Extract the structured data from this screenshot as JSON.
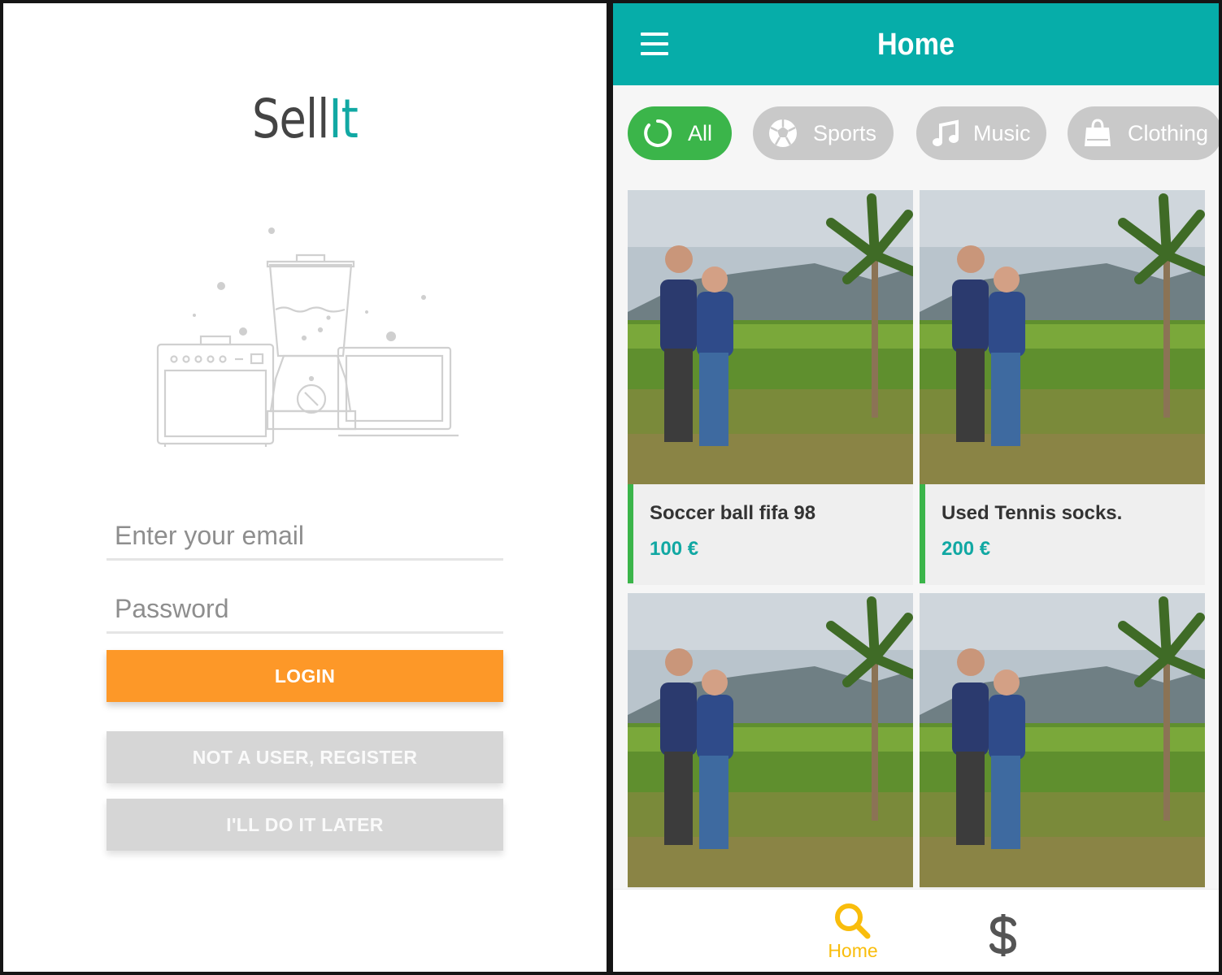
{
  "login_screen": {
    "logo": {
      "part1": "Sell",
      "part2": "It"
    },
    "email_placeholder": "Enter your email",
    "password_placeholder": "Password",
    "login_label": "LOGIN",
    "register_label": "NOT A USER, REGISTER",
    "later_label": "I'LL DO IT LATER"
  },
  "home_screen": {
    "title": "Home",
    "categories": [
      {
        "label": "All",
        "icon": "loading-ring-icon",
        "selected": true
      },
      {
        "label": "Sports",
        "icon": "soccer-ball-icon",
        "selected": false
      },
      {
        "label": "Music",
        "icon": "music-note-icon",
        "selected": false
      },
      {
        "label": "Clothing",
        "icon": "shopping-bag-icon",
        "selected": false
      }
    ],
    "products": [
      {
        "title": "Soccer ball fifa 98",
        "price": "100 €"
      },
      {
        "title": "Used Tennis socks.",
        "price": "200 €"
      },
      {
        "title": "",
        "price": ""
      },
      {
        "title": "",
        "price": ""
      }
    ],
    "bottom_nav": {
      "home_label": "Home",
      "home_icon": "search-icon",
      "sell_icon": "dollar-icon",
      "active_color": "#f9bd0c"
    }
  },
  "colors": {
    "accent_teal": "#06ada9",
    "login_orange": "#fd9828",
    "chip_green": "#3bb54a",
    "chip_gray": "#c9c9c9"
  }
}
